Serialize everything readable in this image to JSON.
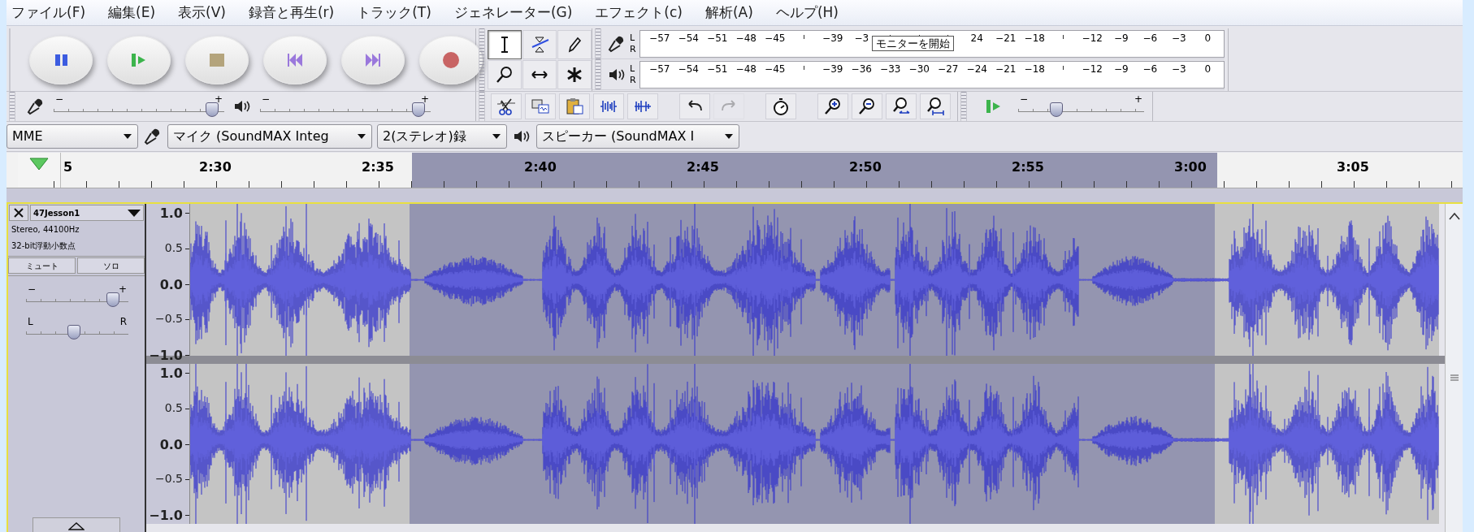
{
  "menu": [
    {
      "label": "ファイル(F)"
    },
    {
      "label": "編集(E)"
    },
    {
      "label": "表示(V)"
    },
    {
      "label": "録音と再生(r)"
    },
    {
      "label": "トラック(T)"
    },
    {
      "label": "ジェネレーター(G)"
    },
    {
      "label": "エフェクト(c)"
    },
    {
      "label": "解析(A)"
    },
    {
      "label": "ヘルプ(H)"
    }
  ],
  "transport": [
    {
      "kind": "pause"
    },
    {
      "kind": "play"
    },
    {
      "kind": "stop"
    },
    {
      "kind": "skip_start"
    },
    {
      "kind": "skip_end"
    },
    {
      "kind": "record"
    }
  ],
  "tools": [
    {
      "kind": "select",
      "selected": true
    },
    {
      "kind": "envelope",
      "selected": false
    },
    {
      "kind": "draw",
      "selected": false
    },
    {
      "kind": "zoom",
      "selected": false
    },
    {
      "kind": "timeshift",
      "selected": false
    },
    {
      "kind": "multi",
      "selected": false
    }
  ],
  "meters": [
    {
      "kind": "record",
      "channels": [
        "L",
        "R"
      ],
      "scale": [
        {
          "kind": "label",
          "text": "−57"
        },
        {
          "kind": "label",
          "text": "−54"
        },
        {
          "kind": "label",
          "text": "−51"
        },
        {
          "kind": "label",
          "text": "−48"
        },
        {
          "kind": "label",
          "text": "−45"
        },
        {
          "kind": "tick"
        },
        {
          "kind": "label",
          "text": "−39"
        },
        {
          "kind": "label",
          "text": "−3"
        },
        {
          "kind": "tick"
        },
        {
          "kind": "tick"
        },
        {
          "kind": "tick"
        },
        {
          "kind": "label",
          "text": "24"
        },
        {
          "kind": "label",
          "text": "−21"
        },
        {
          "kind": "label",
          "text": "−18"
        },
        {
          "kind": "tick"
        },
        {
          "kind": "label",
          "text": "−12"
        },
        {
          "kind": "label",
          "text": "−9"
        },
        {
          "kind": "label",
          "text": "−6"
        },
        {
          "kind": "label",
          "text": "−3"
        },
        {
          "kind": "label",
          "text": "0"
        }
      ],
      "tooltip": "モニターを開始"
    },
    {
      "kind": "playback",
      "channels": [
        "L",
        "R"
      ],
      "scale": [
        {
          "kind": "label",
          "text": "−57"
        },
        {
          "kind": "label",
          "text": "−54"
        },
        {
          "kind": "label",
          "text": "−51"
        },
        {
          "kind": "label",
          "text": "−48"
        },
        {
          "kind": "label",
          "text": "−45"
        },
        {
          "kind": "tick"
        },
        {
          "kind": "label",
          "text": "−39"
        },
        {
          "kind": "label",
          "text": "−36"
        },
        {
          "kind": "label",
          "text": "−33"
        },
        {
          "kind": "label",
          "text": "−30"
        },
        {
          "kind": "label",
          "text": "−27"
        },
        {
          "kind": "label",
          "text": "−24"
        },
        {
          "kind": "label",
          "text": "−21"
        },
        {
          "kind": "label",
          "text": "−18"
        },
        {
          "kind": "tick"
        },
        {
          "kind": "label",
          "text": "−12"
        },
        {
          "kind": "label",
          "text": "−9"
        },
        {
          "kind": "label",
          "text": "−6"
        },
        {
          "kind": "label",
          "text": "−3"
        },
        {
          "kind": "label",
          "text": "0"
        }
      ]
    }
  ],
  "mixer": [
    {
      "kind": "input",
      "level": 0.93,
      "min_label": "−",
      "max_label": "+"
    },
    {
      "kind": "output",
      "level": 0.93,
      "min_label": "−",
      "max_label": "+"
    }
  ],
  "edit_tools": [
    {
      "kind": "cut",
      "disabled": false
    },
    {
      "kind": "copy",
      "disabled": false
    },
    {
      "kind": "paste",
      "disabled": false
    },
    {
      "kind": "trim",
      "disabled": false
    },
    {
      "kind": "silence",
      "disabled": false
    },
    {
      "kind": "undo",
      "disabled": false
    },
    {
      "kind": "redo",
      "disabled": true
    },
    {
      "kind": "sync",
      "disabled": false
    },
    {
      "kind": "zoom_in",
      "disabled": false
    },
    {
      "kind": "zoom_out",
      "disabled": false
    },
    {
      "kind": "fit_selection",
      "disabled": false
    },
    {
      "kind": "fit_project",
      "disabled": false
    }
  ],
  "play_at_speed": {
    "level": 0.3,
    "min_label": "−",
    "max_label": "+"
  },
  "devices": [
    {
      "kind": "host",
      "value": "MME"
    },
    {
      "kind": "input",
      "value": "マイク (SoundMAX Integ"
    },
    {
      "kind": "channels",
      "value": "2(ステレオ)録"
    },
    {
      "kind": "output",
      "value": "スピーカー (SoundMAX I"
    }
  ],
  "ruler": {
    "labels": [
      "5",
      "2:30",
      "2:35",
      "2:40",
      "2:45",
      "2:50",
      "2:55",
      "3:00",
      "3:05"
    ]
  },
  "track": {
    "name": "47Jesson1",
    "selected": true,
    "info": [
      "Stereo, 44100Hz",
      "32-bit浮動小数点"
    ],
    "buttons": [
      "ミュート",
      "ソロ"
    ],
    "gain": {
      "level": 0.85,
      "min_label": "−",
      "max_label": "+"
    },
    "pan": {
      "level": 0.47,
      "min_label": "L",
      "max_label": "R"
    },
    "channels": [
      {
        "scale": [
          "1.0",
          "0.5",
          "0.0",
          "−0.5",
          "−1.0"
        ]
      },
      {
        "scale": [
          "1.0",
          "0.5",
          "0.0",
          "−0.5",
          "−1.0"
        ]
      }
    ]
  }
}
